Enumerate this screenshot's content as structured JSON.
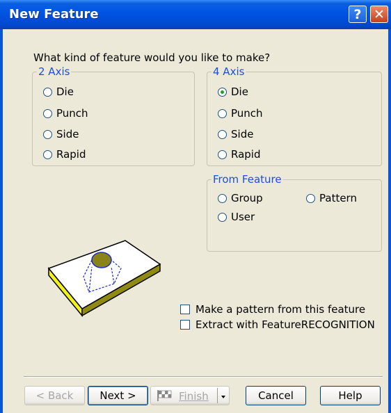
{
  "window": {
    "title": "New Feature",
    "help_label": "?",
    "close_label": "✕"
  },
  "prompt": "What kind of feature would you like to make?",
  "axis2": {
    "label": "2 Axis",
    "options": [
      "Die",
      "Punch",
      "Side",
      "Rapid"
    ]
  },
  "axis4": {
    "label": "4 Axis",
    "options": [
      "Die",
      "Punch",
      "Side",
      "Rapid"
    ],
    "selected": "Die"
  },
  "from_feature": {
    "label": "From Feature",
    "options": [
      "Group",
      "Pattern",
      "User"
    ]
  },
  "checkboxes": {
    "pattern": "Make a pattern from this feature",
    "extract": "Extract with FeatureRECOGNITION"
  },
  "buttons": {
    "back": "< Back",
    "next": "Next >",
    "finish": "Finish",
    "cancel": "Cancel",
    "help": "Help"
  },
  "icons": {
    "finish": "checkered-flag-icon",
    "preview": "feature-block-preview"
  }
}
